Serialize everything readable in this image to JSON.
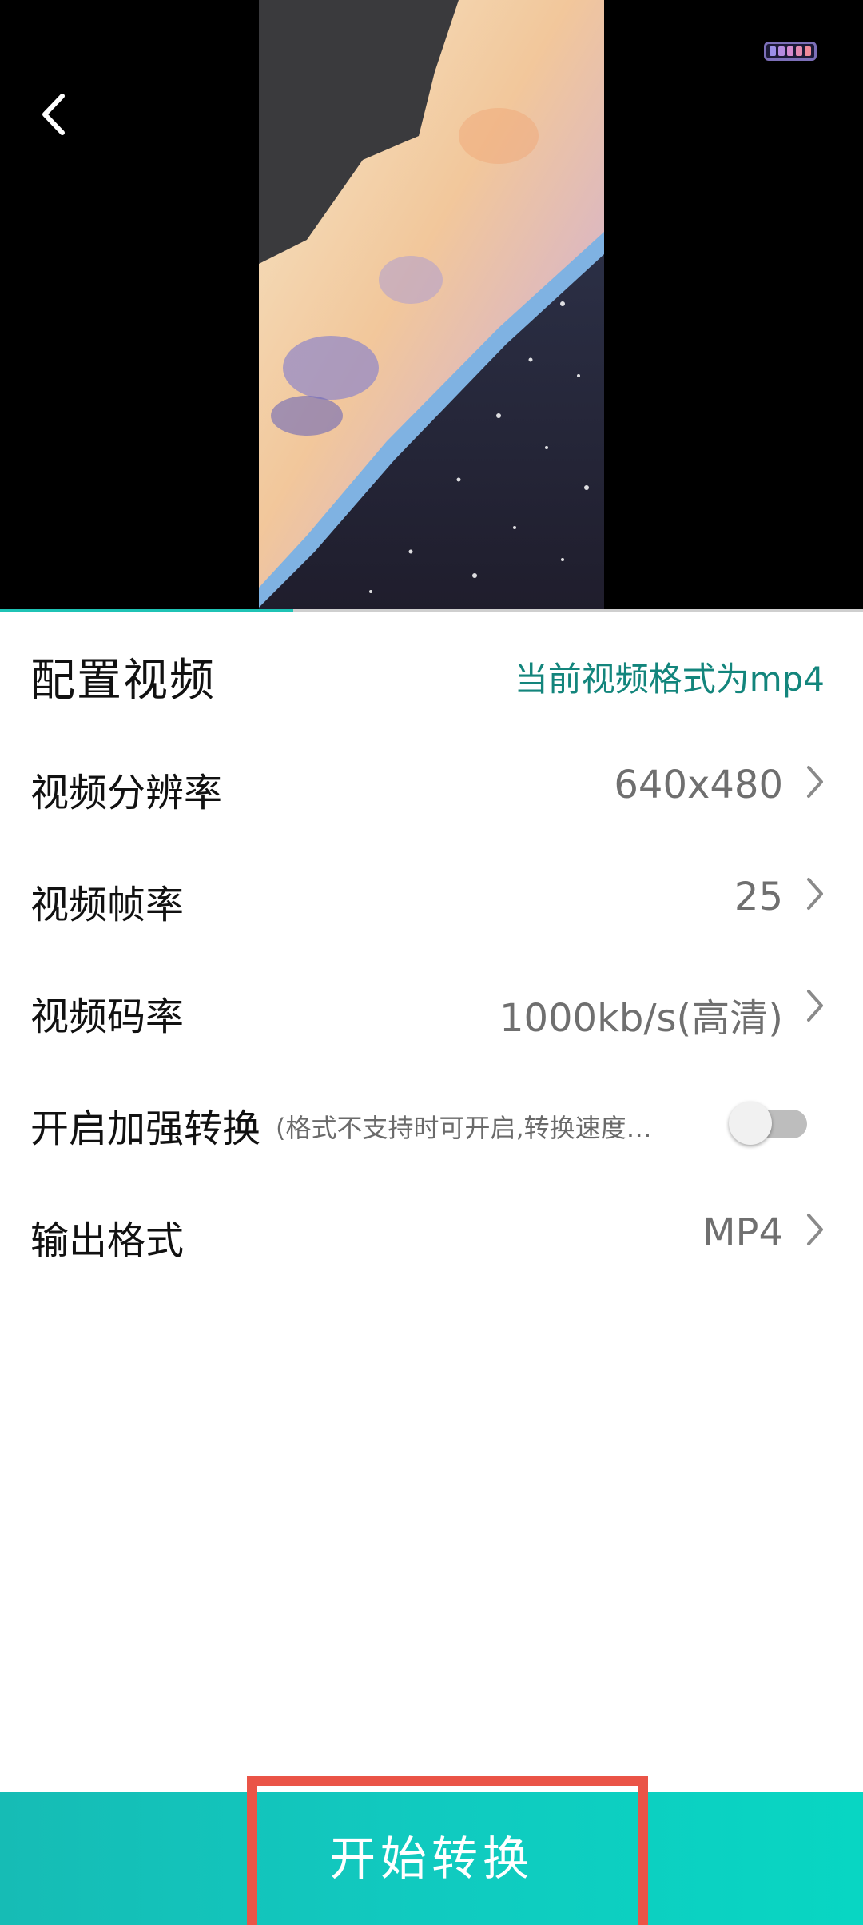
{
  "video": {
    "back_icon": "chevron-left-icon",
    "indicator_colors": [
      "#9b8fe8",
      "#b58be0",
      "#d58bcf",
      "#e38ab0",
      "#f08a9a"
    ],
    "progress": 0.34
  },
  "settings": {
    "title": "配置视频",
    "format_hint": "当前视频格式为mp4",
    "rows": [
      {
        "label": "视频分辨率",
        "value": "640x480"
      },
      {
        "label": "视频帧率",
        "value": "25"
      },
      {
        "label": "视频码率",
        "value": "1000kb/s(高清)"
      }
    ],
    "enhance": {
      "label": "开启加强转换",
      "note": "(格式不支持时可开启,转换速度…",
      "enabled": false
    },
    "output": {
      "label": "输出格式",
      "value": "MP4"
    }
  },
  "action": {
    "start_label": "开始转换"
  },
  "colors": {
    "accent": "#13857c",
    "button_gradient_start": "#16bcb5",
    "button_gradient_end": "#08d6c3",
    "highlight": "#ea5447"
  }
}
